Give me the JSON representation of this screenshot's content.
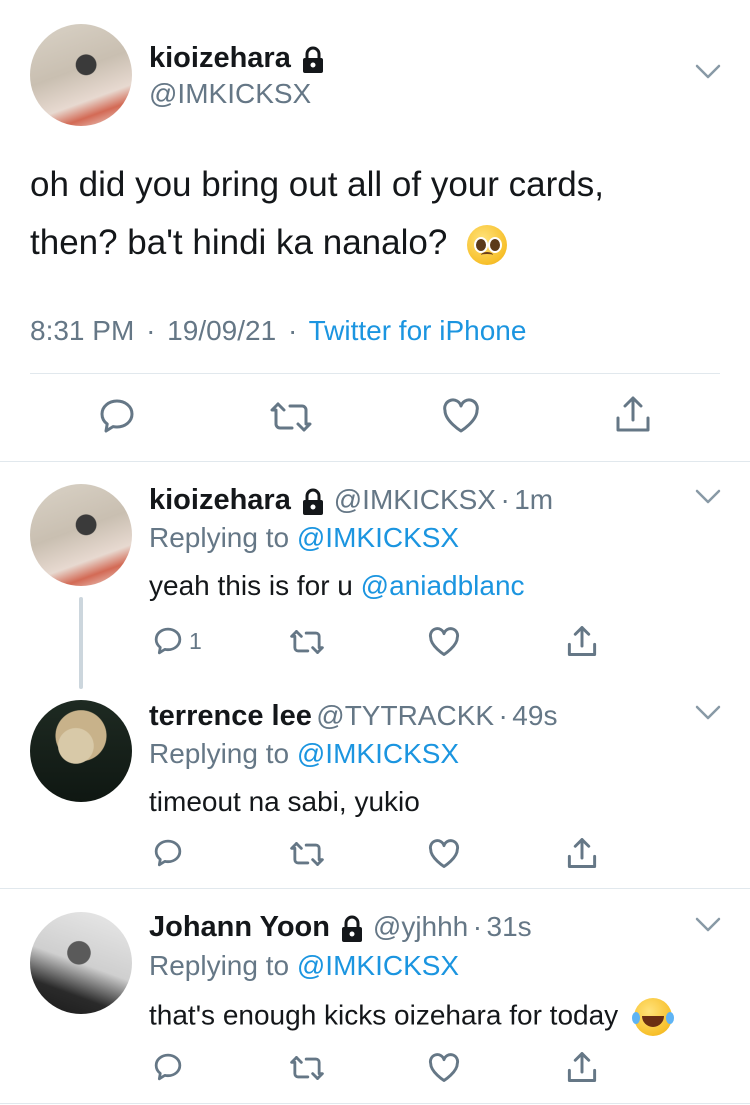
{
  "main_tweet": {
    "display_name": "kioizehara",
    "handle": "@IMKICKSX",
    "text_line1": "oh did you bring out all of your cards,",
    "text_line2": "then? ba't hindi ka nanalo?",
    "time": "8:31 PM",
    "date": "19/09/21",
    "source": "Twitter for iPhone",
    "sep": "·"
  },
  "replies": [
    {
      "display_name": "kioizehara",
      "handle": "@IMKICKSX",
      "age": "1m",
      "replying_label": "Replying to",
      "replying_to": "@IMKICKSX",
      "text": "yeah this is for u",
      "mention": "@aniadblanc",
      "reply_count": "1"
    },
    {
      "display_name": "terrence lee",
      "handle": "@TYTRACKK",
      "age": "49s",
      "replying_label": "Replying to",
      "replying_to": "@IMKICKSX",
      "text": "timeout na sabi, yukio"
    },
    {
      "display_name": "Johann Yoon",
      "handle": "@yjhhh",
      "age": "31s",
      "replying_label": "Replying to",
      "replying_to": "@IMKICKSX",
      "text": "that's enough kicks oizehara for today"
    }
  ],
  "sep": "·",
  "colors": {
    "link": "#1b95e0",
    "muted": "#657786",
    "text": "#14171a",
    "divider": "#e1e8ed"
  }
}
